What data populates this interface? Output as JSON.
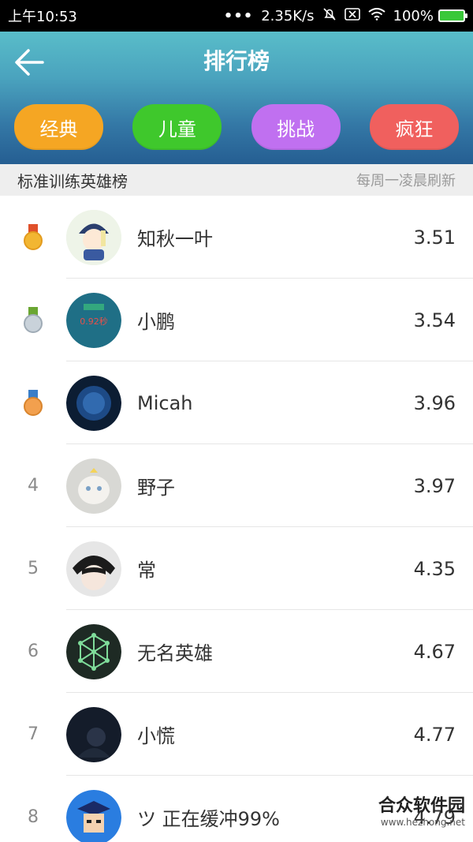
{
  "status_bar": {
    "time": "上午10:53",
    "network_speed": "2.35K/s",
    "battery": "100%"
  },
  "header": {
    "title": "排行榜"
  },
  "tabs": [
    {
      "label": "经典",
      "color": "#f5a623"
    },
    {
      "label": "儿童",
      "color": "#3fc82c"
    },
    {
      "label": "挑战",
      "color": "#c070f0"
    },
    {
      "label": "疯狂",
      "color": "#f0605e"
    }
  ],
  "section": {
    "title": "标准训练英雄榜",
    "refresh_note": "每周一凌晨刷新"
  },
  "leaderboard": [
    {
      "rank": "1",
      "name": "知秋一叶",
      "score": "3.51",
      "medal": "gold-medal-icon"
    },
    {
      "rank": "2",
      "name": "小鹏",
      "score": "3.54",
      "medal": "silver-medal-icon"
    },
    {
      "rank": "3",
      "name": "Micah",
      "score": "3.96",
      "medal": "bronze-medal-icon"
    },
    {
      "rank": "4",
      "name": "野子",
      "score": "3.97"
    },
    {
      "rank": "5",
      "name": "常",
      "score": "4.35"
    },
    {
      "rank": "6",
      "name": "无名英雄",
      "score": "4.67"
    },
    {
      "rank": "7",
      "name": "小慌",
      "score": "4.77"
    },
    {
      "rank": "8",
      "name": "ツ 正在缓冲99%",
      "score": "4.79"
    }
  ],
  "watermark": {
    "text": "合众软件园",
    "url": "www.hezhong.net"
  }
}
